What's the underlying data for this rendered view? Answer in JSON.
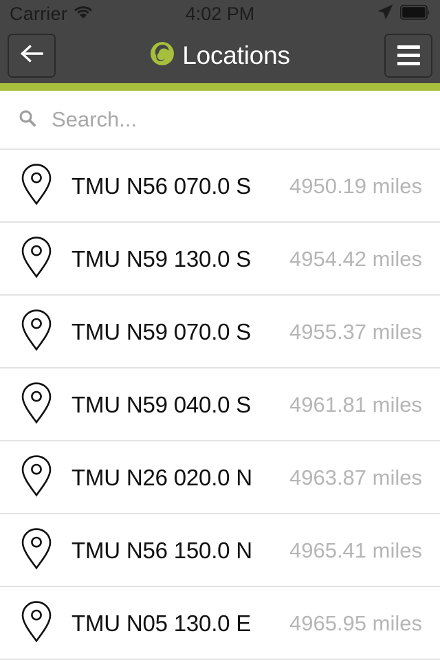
{
  "colors": {
    "accent_green": "#A6BF3C",
    "header_gray": "#454545",
    "status_text": "#1C1C1C",
    "title_white": "#FFFFFF",
    "row_title": "#111111",
    "row_distance": "#B6B6B6",
    "separator": "#E3E3E3",
    "placeholder": "#A8A8A8"
  },
  "status_bar": {
    "carrier": "Carrier",
    "wifi_icon": "wifi-icon",
    "time": "4:02 PM",
    "location_icon": "location-arrow-icon",
    "battery_icon": "battery-full-icon"
  },
  "nav": {
    "back_icon": "back-arrow-icon",
    "logo_icon": "app-logo-icon",
    "title": "Locations",
    "menu_icon": "hamburger-menu-icon"
  },
  "search": {
    "icon": "search-icon",
    "value": "",
    "placeholder": "Search..."
  },
  "list": {
    "pin_icon": "map-pin-icon",
    "items": [
      {
        "title": "TMU N56 070.0 S",
        "distance": "4950.19 miles"
      },
      {
        "title": "TMU N59 130.0 S",
        "distance": "4954.42 miles"
      },
      {
        "title": "TMU N59 070.0 S",
        "distance": "4955.37 miles"
      },
      {
        "title": "TMU N59 040.0 S",
        "distance": "4961.81 miles"
      },
      {
        "title": "TMU N26 020.0 N",
        "distance": "4963.87 miles"
      },
      {
        "title": "TMU N56 150.0 N",
        "distance": "4965.41 miles"
      },
      {
        "title": "TMU N05 130.0 E",
        "distance": "4965.95 miles"
      }
    ]
  }
}
